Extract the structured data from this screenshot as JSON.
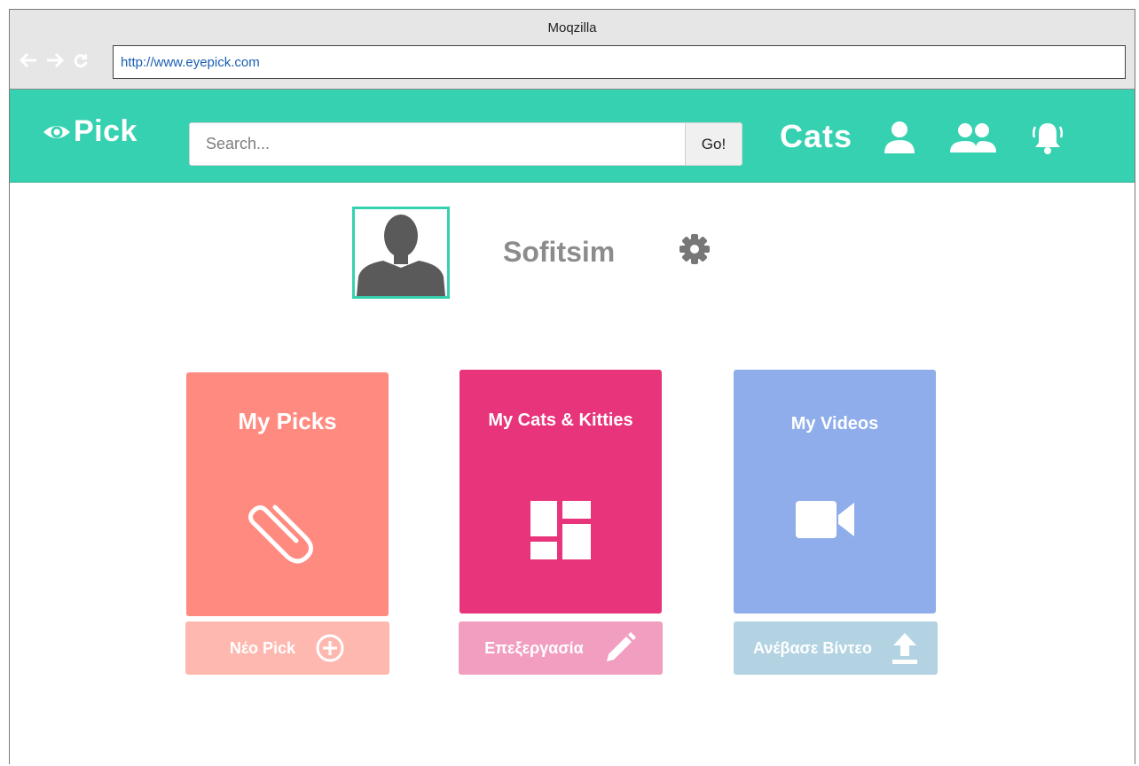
{
  "browser": {
    "title": "Moqzilla",
    "url": "http://www.eyepick.com"
  },
  "header": {
    "logo_text": "Pick",
    "search_placeholder": "Search...",
    "go_label": "Go!",
    "section_label": "Cats",
    "icons": [
      "user-icon",
      "group-icon",
      "bell-icon"
    ]
  },
  "profile": {
    "username": "Sofitsim"
  },
  "cards": [
    {
      "title": "My Picks",
      "icon": "paperclip-icon",
      "action_label": "Νέο Pick",
      "action_icon": "plus-circle-icon",
      "color": "#ff8a80",
      "action_color": "#ffb8b0"
    },
    {
      "title": "My Cats & Kitties",
      "icon": "dashboard-grid-icon",
      "action_label": "Επεξεργασία",
      "action_icon": "pencil-icon",
      "color": "#e8347a",
      "action_color": "#f19ec0"
    },
    {
      "title": "My Videos",
      "icon": "video-camera-icon",
      "action_label": "Ανέβασε Βίντεο",
      "action_icon": "upload-icon",
      "color": "#8fadea",
      "action_color": "#b3d3e3"
    }
  ],
  "colors": {
    "brand": "#36d1b0",
    "chrome": "#e6e6e6"
  }
}
